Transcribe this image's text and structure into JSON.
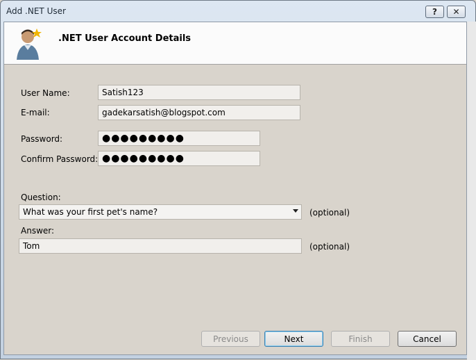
{
  "window": {
    "title": "Add .NET User",
    "help_label": "?",
    "close_label": "✕"
  },
  "header": {
    "title": ".NET User Account Details",
    "icon": "user-account-icon"
  },
  "form": {
    "username": {
      "label": "User Name:",
      "value": "Satish123"
    },
    "email": {
      "label": "E-mail:",
      "value": "gadekarsatish@blogspot.com"
    },
    "password": {
      "label": "Password:",
      "value": "●●●●●●●●●"
    },
    "confirm_password": {
      "label": "Confirm Password:",
      "value": "●●●●●●●●●"
    },
    "question": {
      "label": "Question:",
      "value": "What was your first pet's name?",
      "note": "(optional)"
    },
    "answer": {
      "label": "Answer:",
      "value": "Tom",
      "note": "(optional)"
    }
  },
  "buttons": {
    "previous": "Previous",
    "next": "Next",
    "finish": "Finish",
    "cancel": "Cancel"
  }
}
